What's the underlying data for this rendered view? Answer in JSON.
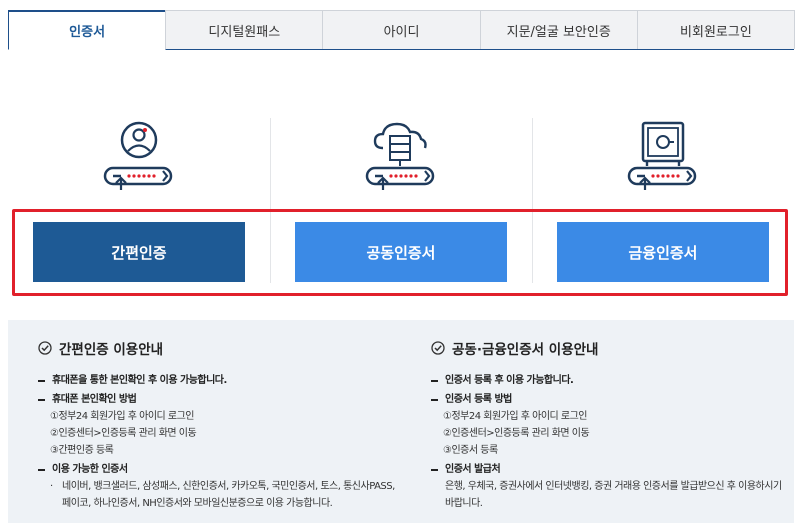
{
  "tabs": [
    {
      "label": "인증서",
      "active": true
    },
    {
      "label": "디지털원패스",
      "active": false
    },
    {
      "label": "아이디",
      "active": false
    },
    {
      "label": "지문/얼굴 보안인증",
      "active": false
    },
    {
      "label": "비회원로그인",
      "active": false
    }
  ],
  "methods": [
    {
      "icon": "user-key-icon",
      "button": "간편인증"
    },
    {
      "icon": "cloud-server-key-icon",
      "button": "공동인증서"
    },
    {
      "icon": "safe-key-icon",
      "button": "금융인증서"
    }
  ],
  "colors": {
    "primary": "#1e5a95",
    "secondary": "#3b8ae6",
    "highlight": "#e1202b",
    "panel": "#eef2f6"
  },
  "info": {
    "left": {
      "title": "간편인증 이용안내",
      "items": {
        "h1": "휴대폰을 통한 본인확인 후 이용 가능합니다.",
        "h2": "휴대폰 본인확인 방법",
        "s1": "①정부24 회원가입 후 아이디 로그인",
        "s2": "②인증센터>인증등록 관리 화면 이동",
        "s3": "③간편인증 등록",
        "h3": "이용 가능한 인증서",
        "b1": "네이버, 뱅크샐러드, 삼성패스, 신한인증서, 카카오톡, 국민인증서, 토스, 통신사PASS, 페이코, 하나인증서, NH인증서와 모바일신분증으로 이용 가능합니다."
      }
    },
    "right": {
      "title": "공동·금융인증서 이용안내",
      "items": {
        "h1": "인증서 등록 후 이용 가능합니다.",
        "h2": "인증서 등록 방법",
        "s1": "①정부24 회원가입 후 아이디 로그인",
        "s2": "②인증센터>인증등록 관리 화면 이동",
        "s3": "③인증서 등록",
        "h3": "인증서 발급처",
        "p1": "은행, 우체국, 증권사에서 인터넷뱅킹, 증권 거래용 인증서를 발급받으신 후 이용하시기 바랍니다."
      }
    }
  }
}
